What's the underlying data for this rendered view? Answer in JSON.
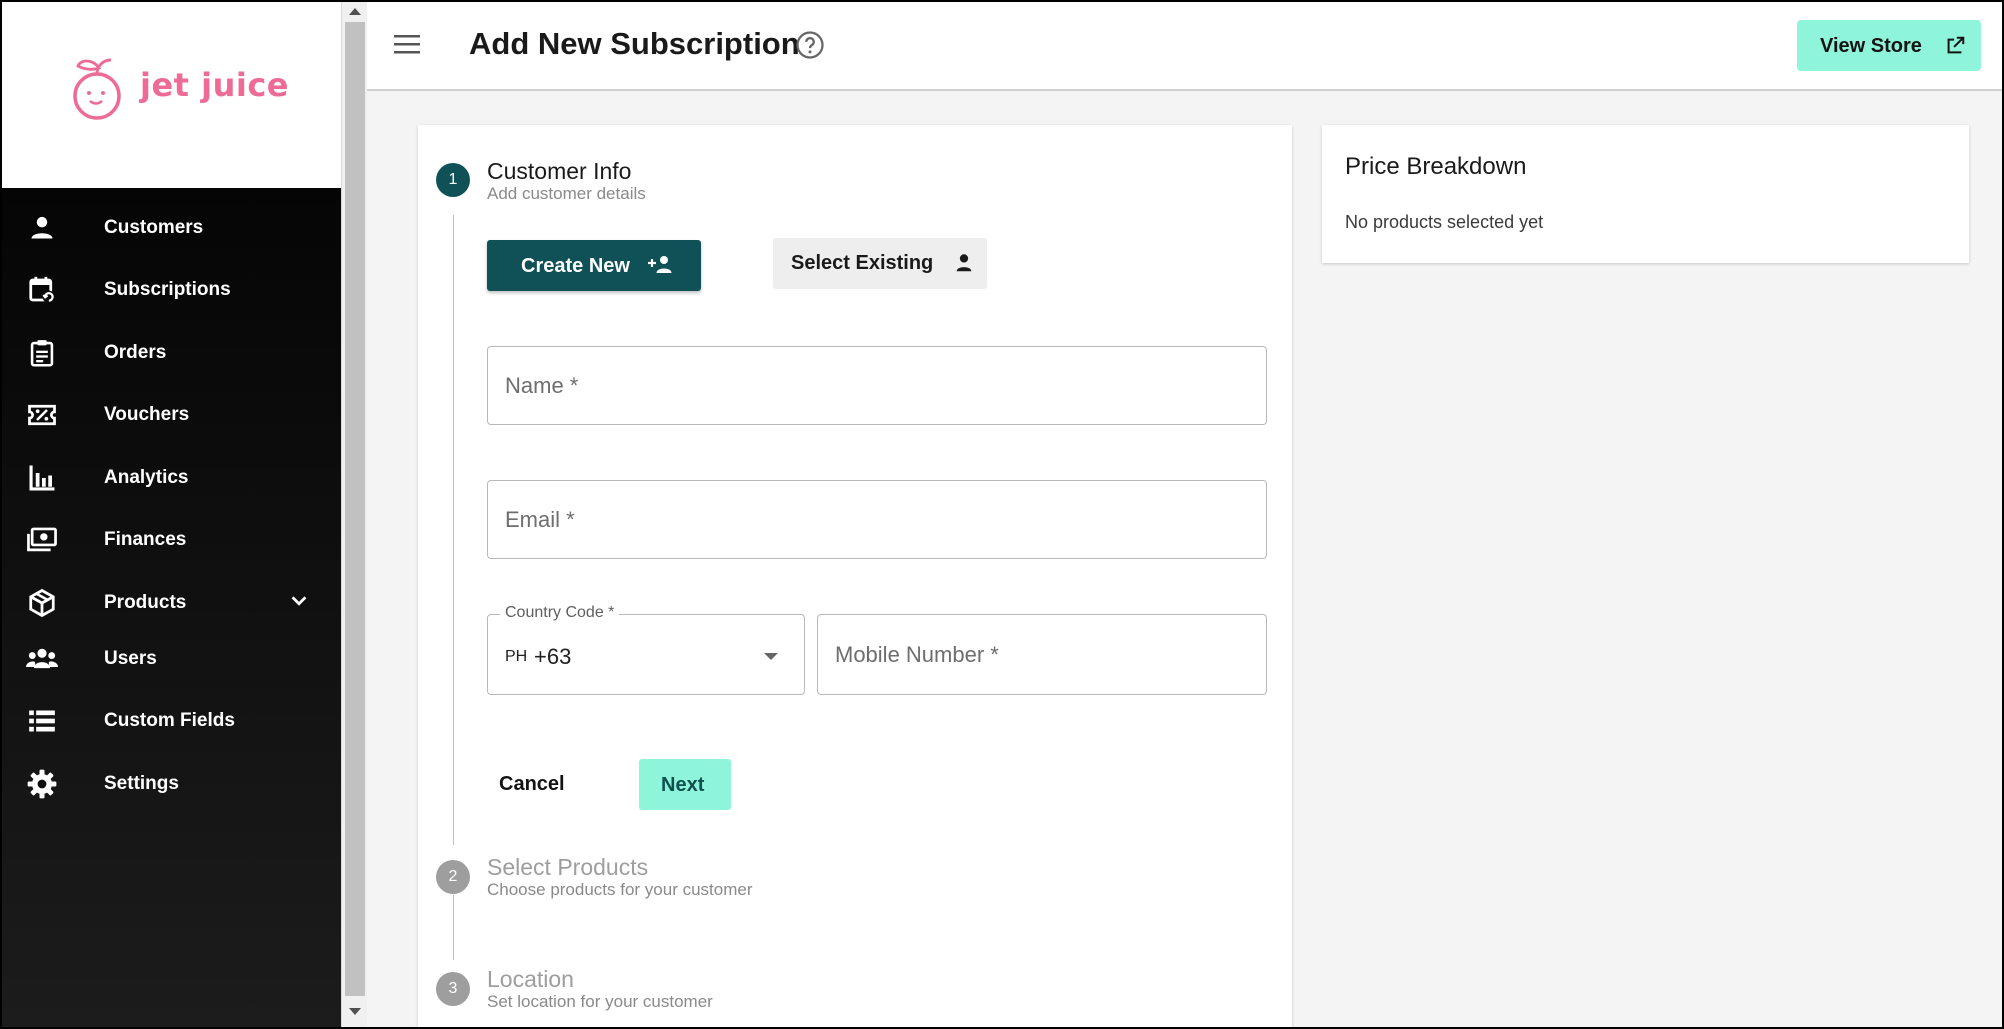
{
  "brand": {
    "name": "jet juice",
    "color": "#ee6b95"
  },
  "sidebar": {
    "items": [
      {
        "label": "Customers",
        "icon": "person-icon"
      },
      {
        "label": "Subscriptions",
        "icon": "calendar-sync-icon"
      },
      {
        "label": "Orders",
        "icon": "clipboard-icon"
      },
      {
        "label": "Vouchers",
        "icon": "ticket-percent-icon"
      },
      {
        "label": "Analytics",
        "icon": "bar-chart-icon"
      },
      {
        "label": "Finances",
        "icon": "money-icon"
      },
      {
        "label": "Products",
        "icon": "box-icon",
        "expandable": true
      },
      {
        "label": "Users",
        "icon": "group-icon"
      },
      {
        "label": "Custom Fields",
        "icon": "list-icon"
      },
      {
        "label": "Settings",
        "icon": "gear-icon"
      }
    ]
  },
  "header": {
    "title": "Add New Subscription",
    "view_store_label": "View Store"
  },
  "stepper": {
    "steps": [
      {
        "number": "1",
        "title": "Customer Info",
        "subtitle": "Add customer details",
        "active": true
      },
      {
        "number": "2",
        "title": "Select Products",
        "subtitle": "Choose products for your customer",
        "active": false
      },
      {
        "number": "3",
        "title": "Location",
        "subtitle": "Set location for your customer",
        "active": false
      }
    ]
  },
  "customer_form": {
    "create_new_label": "Create New",
    "select_existing_label": "Select Existing",
    "name_placeholder": "Name *",
    "email_placeholder": "Email *",
    "country_code_label": "Country Code *",
    "country_code_flag": "PH",
    "country_code_value": "+63",
    "mobile_placeholder": "Mobile Number *",
    "cancel_label": "Cancel",
    "next_label": "Next"
  },
  "price_breakdown": {
    "title": "Price Breakdown",
    "empty_text": "No products selected yet"
  },
  "colors": {
    "primary": "#0f5157",
    "accent": "#8ff5da",
    "sidebar_bg": "#0b0b0b"
  }
}
